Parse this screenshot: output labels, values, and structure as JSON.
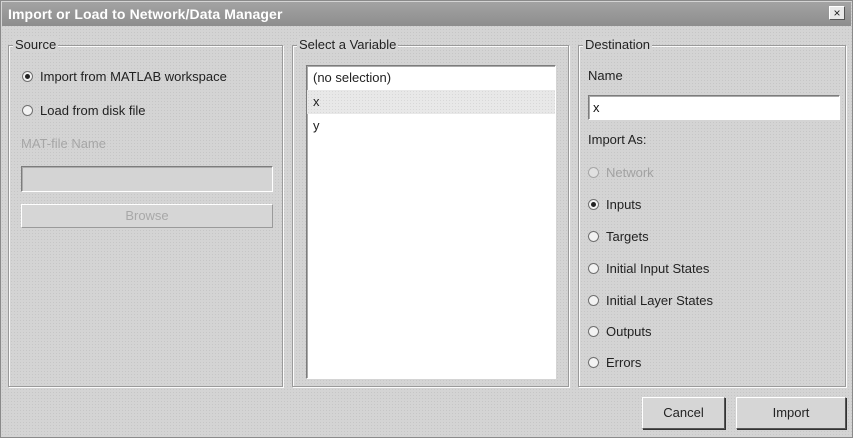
{
  "window": {
    "title": "Import or Load to Network/Data Manager",
    "close_label": "×"
  },
  "source": {
    "legend": "Source",
    "import_workspace_label": "Import from MATLAB workspace",
    "load_disk_label": "Load from disk file",
    "mat_file_label": "MAT-file Name",
    "mat_file_value": "",
    "browse_label": "Browse"
  },
  "variable": {
    "legend": "Select a Variable",
    "items": [
      "(no selection)",
      "x",
      "y"
    ],
    "selected": "x"
  },
  "destination": {
    "legend": "Destination",
    "name_label": "Name",
    "name_value": "x",
    "import_as_label": "Import As:",
    "options": [
      {
        "label": "Network",
        "checked": false,
        "disabled": true
      },
      {
        "label": "Inputs",
        "checked": true,
        "disabled": false
      },
      {
        "label": "Targets",
        "checked": false,
        "disabled": false
      },
      {
        "label": "Initial Input States",
        "checked": false,
        "disabled": false
      },
      {
        "label": "Initial Layer States",
        "checked": false,
        "disabled": false
      },
      {
        "label": "Outputs",
        "checked": false,
        "disabled": false
      },
      {
        "label": "Errors",
        "checked": false,
        "disabled": false
      }
    ]
  },
  "footer": {
    "cancel_label": "Cancel",
    "import_label": "Import"
  }
}
